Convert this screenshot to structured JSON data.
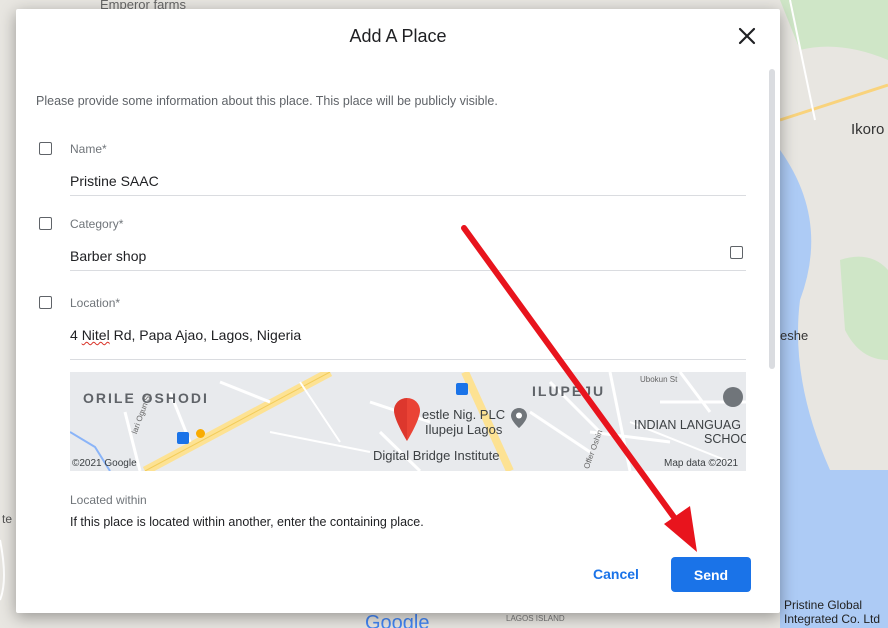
{
  "background": {
    "labels": {
      "top": "Emperor farms",
      "right_city": "Ikoro",
      "right_area": "eshe",
      "left_edge": "te",
      "pristine": "Pristine Global",
      "pristine_line2": "Integrated Co. Ltd",
      "lagos_island": "LAGOS ISLAND",
      "google": "Google"
    }
  },
  "dialog": {
    "title": "Add A Place",
    "subtitle": "Please provide some information about this place. This place will be publicly visible.",
    "fields": {
      "name": {
        "label": "Name*",
        "value": "Pristine SAAC"
      },
      "category": {
        "label": "Category*",
        "value": "Barber shop"
      },
      "location": {
        "label": "Location*",
        "value_pre": "4 ",
        "value_word": "Nitel",
        "value_post": " Rd, Papa Ajao, Lagos, Nigeria"
      }
    },
    "map": {
      "labels": {
        "orile": "ORILE OSHODI",
        "ilupeju": "ILUPEJU",
        "nestle": "estle Nig. PLC",
        "ilupeju_lagos": "Ilupeju Lagos",
        "digital": "Digital Bridge Institute",
        "indian": "INDIAN LANGUAG",
        "school": "SCHOO",
        "ubokun": "Ubokun St",
        "ogun": "lari Ogun St",
        "oshin": "Offer Oshin",
        "copyright": "©2021 Google",
        "mapdata": "Map data ©2021"
      }
    },
    "located_within": {
      "label": "Located within",
      "description": "If this place is located within another, enter the containing place."
    },
    "buttons": {
      "cancel": "Cancel",
      "send": "Send"
    }
  },
  "colors": {
    "primary": "#1a73e8",
    "arrow": "#e8141d",
    "pin": "#ea4335"
  }
}
